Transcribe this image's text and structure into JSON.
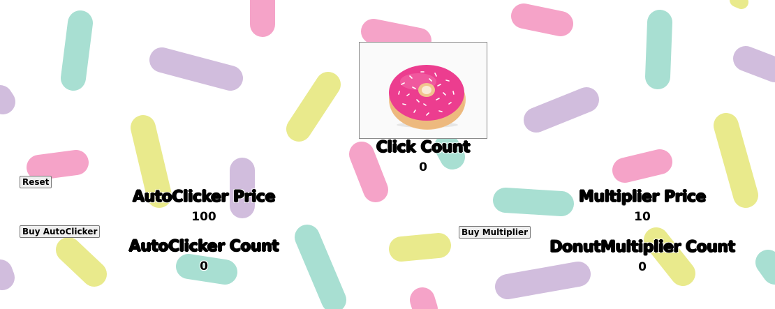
{
  "buttons": {
    "reset": "Reset",
    "buy_autoclicker": "Buy AutoClicker",
    "buy_multiplier": "Buy Multiplier"
  },
  "click": {
    "label": "Click Count",
    "value": "0"
  },
  "autoclicker": {
    "price_label": "AutoClicker Price",
    "price": "100",
    "count_label": "AutoClicker Count",
    "count": "0"
  },
  "multiplier": {
    "price_label": "Multiplier Price",
    "price": "10",
    "count_label": "DonutMultiplier Count",
    "count": "0"
  },
  "colors": {
    "pink": "#f5a3c8",
    "mint": "#a8dfd2",
    "lavender": "#d1bddd",
    "yellow": "#e9ea8c",
    "frosting": "#ec3d8f",
    "dough": "#f1c48e"
  },
  "icons": {
    "donut": "donut-image"
  }
}
